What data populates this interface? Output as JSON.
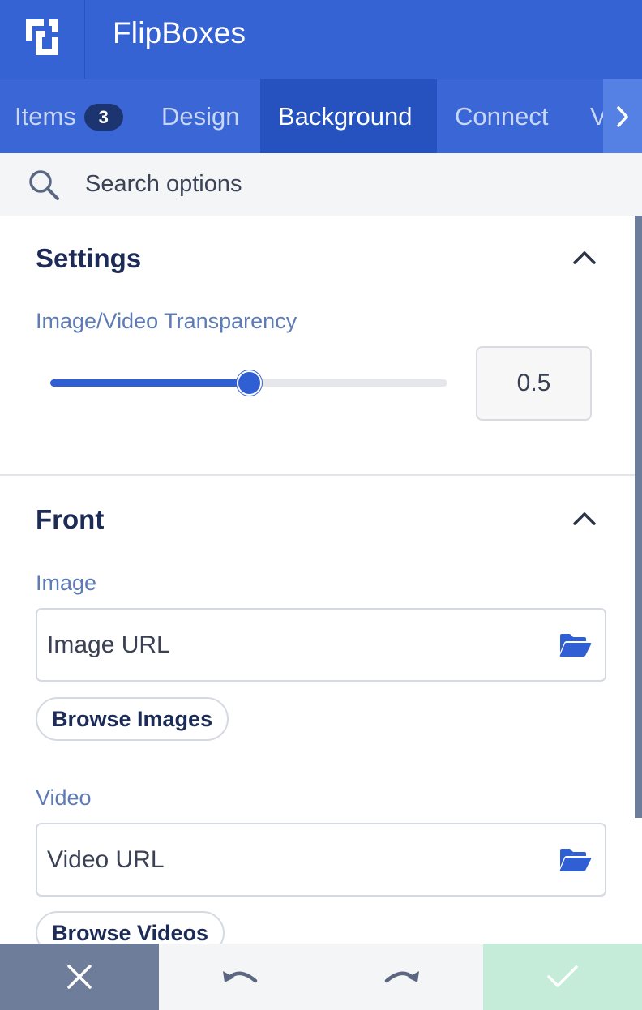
{
  "header": {
    "logo_icon": "flipboxes-logo-icon",
    "title": "FlipBoxes"
  },
  "tabs": [
    {
      "label": "Items",
      "badge": "3",
      "active": false
    },
    {
      "label": "Design",
      "active": false
    },
    {
      "label": "Background",
      "active": true
    },
    {
      "label": "Connect",
      "active": false
    },
    {
      "label": "V",
      "active": false
    }
  ],
  "tab_scroll_icon": "chevron-right-icon",
  "search": {
    "placeholder": "Search options",
    "icon": "search-icon"
  },
  "settings": {
    "title": "Settings",
    "transparency_label": "Image/Video Transparency",
    "transparency_value": "0.5",
    "slider_fraction": 0.5
  },
  "front": {
    "title": "Front",
    "image_label": "Image",
    "image_placeholder": "Image URL",
    "browse_images": "Browse Images",
    "video_label": "Video",
    "video_placeholder": "Video URL",
    "browse_videos": "Browse Videos"
  },
  "bottom_bar": {
    "close_icon": "close-icon",
    "undo_icon": "undo-icon",
    "redo_icon": "redo-icon",
    "save_icon": "checkmark-icon"
  },
  "colors": {
    "header": "#3563d4",
    "active_tab": "#2552bf",
    "accent": "#2f5fd2",
    "save": "#c4ecd9",
    "close": "#6e7d99"
  }
}
